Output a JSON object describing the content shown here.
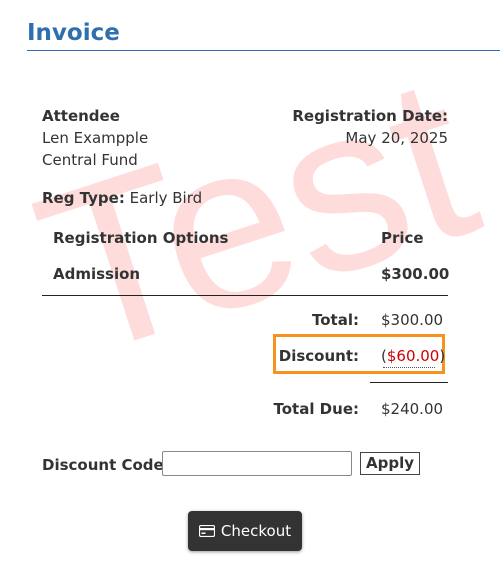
{
  "header": {
    "title": "Invoice"
  },
  "watermark": "Test",
  "attendee": {
    "heading": "Attendee",
    "name": "Len Exampple",
    "organization": "Central Fund"
  },
  "registration_date": {
    "heading": "Registration Date:",
    "value": "May 20, 2025"
  },
  "reg_type": {
    "label": "Reg Type:",
    "value": "Early Bird"
  },
  "table": {
    "columns": [
      "Registration Options",
      "Price"
    ],
    "rows": [
      {
        "option": "Admission",
        "price": "$300.00"
      }
    ]
  },
  "totals": {
    "total_label": "Total:",
    "total_value": "$300.00",
    "discount_label": "Discount:",
    "discount_open": "(",
    "discount_value": "$60.00",
    "discount_close": ")",
    "due_label": "Total Due:",
    "due_value": "$240.00"
  },
  "discount_code": {
    "label": "Discount Code:",
    "value": "",
    "apply_label": "Apply"
  },
  "checkout": {
    "label": "Checkout",
    "icon": "credit-card-icon"
  },
  "colors": {
    "accent": "#2f6fae",
    "highlight": "#f6921e",
    "discount": "#cc0000",
    "button": "#333333"
  }
}
